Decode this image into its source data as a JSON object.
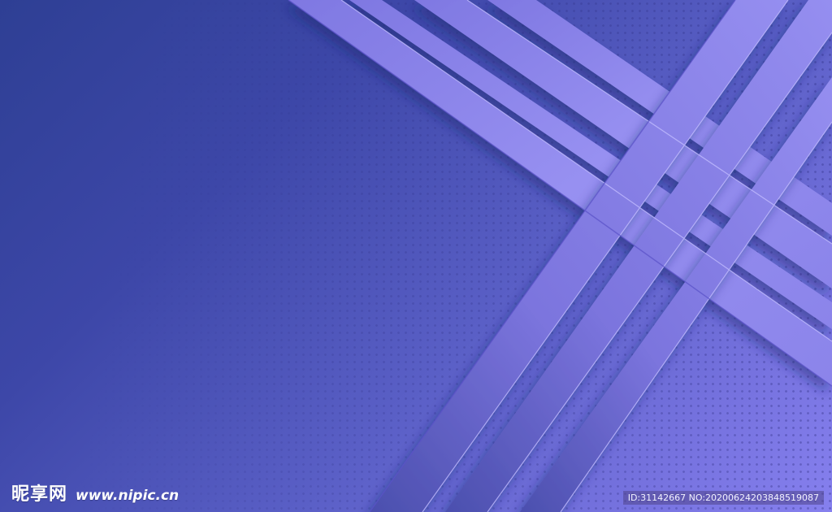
{
  "background": {
    "colors": {
      "deep": "#2e3f94",
      "mid": "#5a5fc6",
      "light": "#8680ee",
      "ribbon": "#8b84ea",
      "ribbon_highlight": "#b9b2ff"
    }
  },
  "watermark": {
    "logo_text": "昵享网",
    "url_text": "www.nipic.cn",
    "id_text": "ID:31142667 NO:20200624203848519087"
  }
}
